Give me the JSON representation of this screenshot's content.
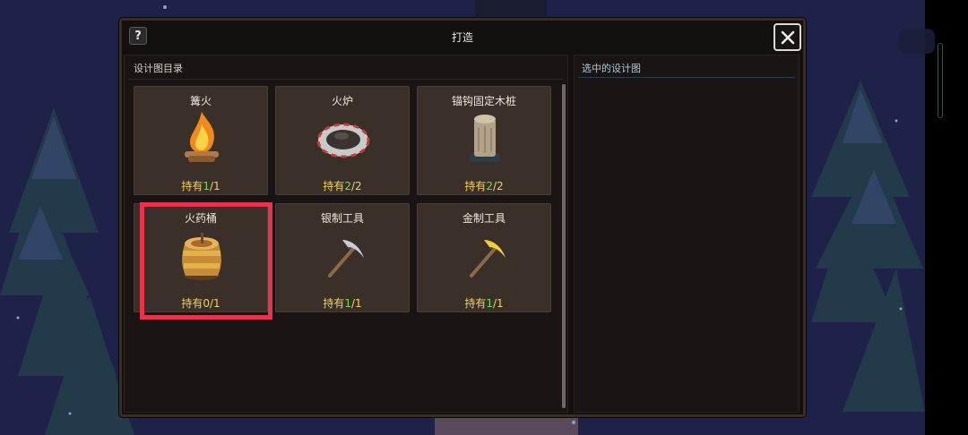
{
  "dialog": {
    "help_label": "?",
    "title": "打造",
    "close_label": "close"
  },
  "list_panel": {
    "header": "设计图目录",
    "items": [
      {
        "name": "篝火",
        "icon": "campfire-icon",
        "own_prefix": "持有",
        "owned": "1",
        "total": "/1"
      },
      {
        "name": "火炉",
        "icon": "furnace-icon",
        "own_prefix": "持有",
        "owned": "2",
        "total": "/2"
      },
      {
        "name": "锚钩固定木桩",
        "icon": "wooden-stake-icon",
        "own_prefix": "持有",
        "owned": "2",
        "total": "/2"
      },
      {
        "name": "火药桶",
        "icon": "powder-keg-icon",
        "own_prefix": "持有",
        "owned": "0",
        "total": "/1"
      },
      {
        "name": "银制工具",
        "icon": "silver-pickaxe-icon",
        "own_prefix": "持有",
        "owned": "1",
        "total": "/1"
      },
      {
        "name": "金制工具",
        "icon": "gold-pickaxe-icon",
        "own_prefix": "持有",
        "owned": "1",
        "total": "/1"
      }
    ]
  },
  "detail_panel": {
    "header": "选中的设计图"
  },
  "colors": {
    "owned_nonzero": "#6fdd5a",
    "owned_label": "#f2d15e",
    "highlight": "#e8334f"
  }
}
